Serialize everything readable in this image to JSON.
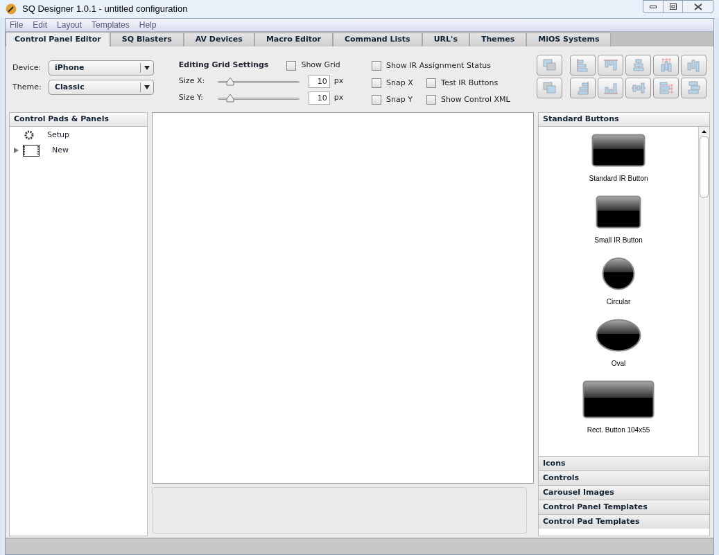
{
  "window": {
    "title": "SQ Designer 1.0.1 - untitled configuration"
  },
  "menu": [
    "File",
    "Edit",
    "Layout",
    "Templates",
    "Help"
  ],
  "tabs": [
    {
      "label": "Control Panel Editor",
      "selected": true
    },
    {
      "label": "SQ Blasters",
      "selected": false
    },
    {
      "label": "AV Devices",
      "selected": false
    },
    {
      "label": "Macro Editor",
      "selected": false
    },
    {
      "label": "Command Lists",
      "selected": false
    },
    {
      "label": "URL's",
      "selected": false
    },
    {
      "label": "Themes",
      "selected": false
    },
    {
      "label": "MiOS Systems",
      "selected": false
    }
  ],
  "device": {
    "label": "Device:",
    "value": "iPhone"
  },
  "theme": {
    "label": "Theme:",
    "value": "Classic"
  },
  "grid": {
    "title": "Editing Grid Settings",
    "sliders": [
      {
        "label": "Size X:",
        "level": 0.15,
        "value": "10",
        "unit": "px"
      },
      {
        "label": "Size Y:",
        "level": 0.15,
        "value": "10",
        "unit": "px"
      }
    ]
  },
  "checkboxes": [
    {
      "label": "Show Grid",
      "checked": false
    },
    {
      "label": "Show IR Assignment Status",
      "checked": false
    },
    {
      "label": "Snap X",
      "checked": false
    },
    {
      "label": "Test IR Buttons",
      "checked": false
    },
    {
      "label": "Snap Y",
      "checked": false
    },
    {
      "label": "Show Control XML",
      "checked": false
    }
  ],
  "tree": {
    "title": "Control Pads & Panels",
    "items": [
      {
        "label": "Setup",
        "kind": "setup"
      },
      {
        "label": "New",
        "kind": "film",
        "expanded": false
      }
    ]
  },
  "palette": {
    "title": "Standard Buttons",
    "items": [
      {
        "label": "Standard IR Button",
        "kind": "rect"
      },
      {
        "label": "Small IR Button",
        "kind": "small"
      },
      {
        "label": "Circular",
        "kind": "circle"
      },
      {
        "label": "Oval",
        "kind": "oval"
      },
      {
        "label": "Rect. Button 104x55",
        "kind": "wide"
      }
    ]
  },
  "sections": [
    "Icons",
    "Controls",
    "Carousel Images",
    "Control Panel Templates",
    "Control Pad Templates"
  ]
}
